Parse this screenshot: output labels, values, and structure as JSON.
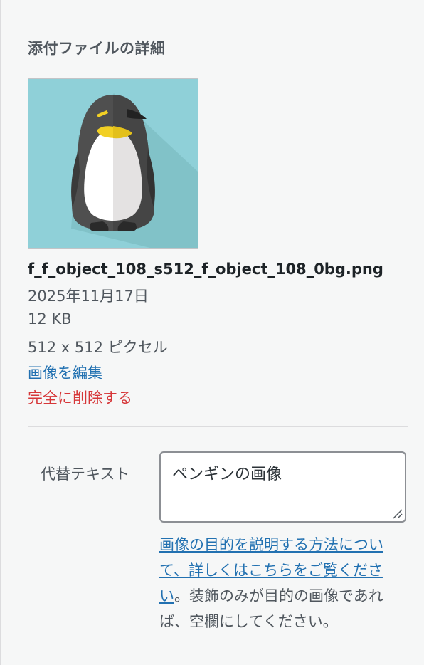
{
  "attachment_details": {
    "heading": "添付ファイルの詳細",
    "thumbnail_icon": "penguin-image",
    "filename": "f_f_object_108_s512_f_object_108_0bg.png",
    "date": "2025年11月17日",
    "file_size": "12 KB",
    "dimensions": "512 x 512 ピクセル",
    "edit_image_label": "画像を編集",
    "delete_permanently_label": "完全に削除する"
  },
  "alt_text": {
    "label": "代替テキスト",
    "value": "ペンギンの画像",
    "help_link": "画像の目的を説明する方法について、詳しくはこちらをご覧ください",
    "help_suffix": "。装飾のみが目的の画像であれば、空欄にしてください。"
  },
  "colors": {
    "link": "#2271b1",
    "delete": "#d63638",
    "thumbnail_background": "#8fd0d8"
  }
}
